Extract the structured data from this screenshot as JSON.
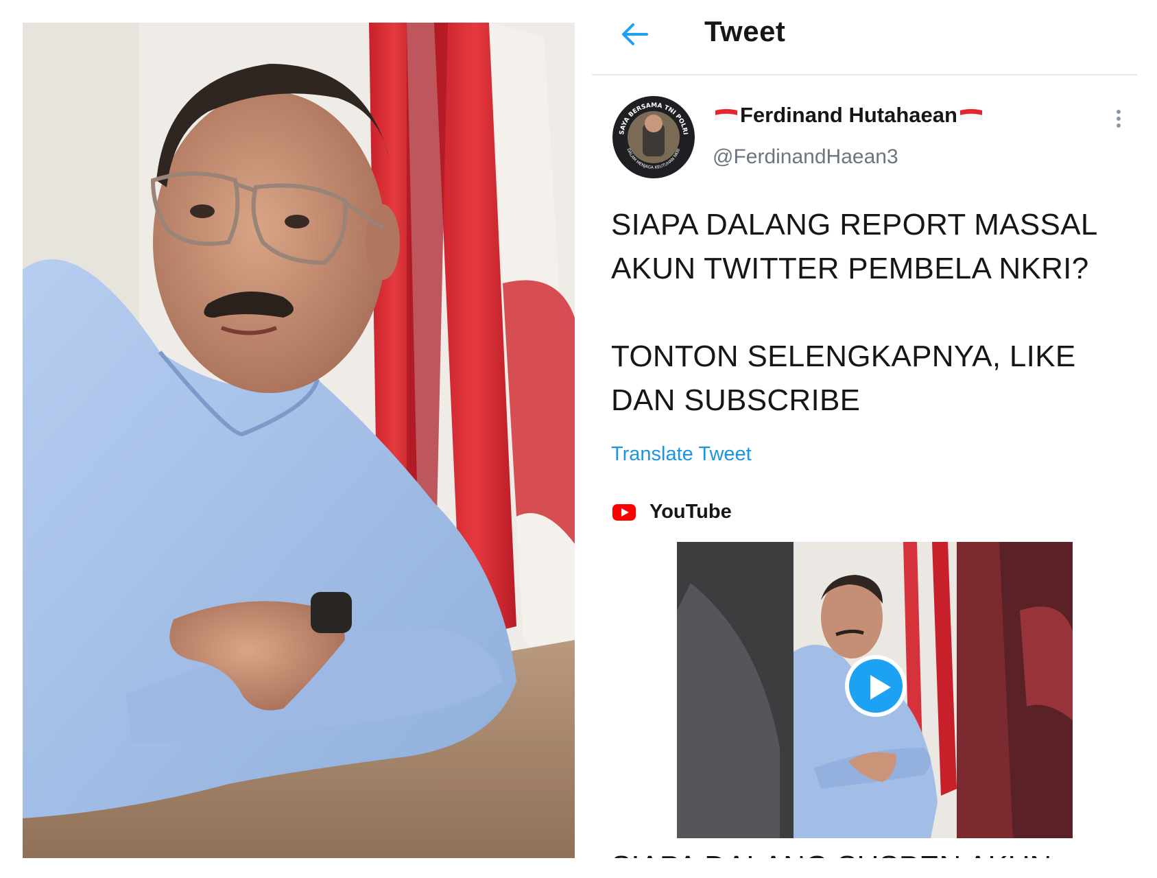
{
  "header": {
    "title": "Tweet",
    "back_icon": "arrow-left-icon"
  },
  "tweet": {
    "display_name": "Ferdinand Hutahaean",
    "handle": "@FerdinandHaean3",
    "avatar_text_top": "SAYA BERSAMA TNI POLRI",
    "avatar_text_bottom": "DALAM MENJAGA KEUTUHAN NKRI",
    "text_paragraph_1_line_1": "SIAPA DALANG REPORT MASSAL",
    "text_paragraph_1_line_2": "AKUN TWITTER PEMBELA NKRI?",
    "text_paragraph_2_line_1": "TONTON SELENGKAPNYA, LIKE",
    "text_paragraph_2_line_2": "DAN SUBSCRIBE",
    "translate_label": "Translate Tweet",
    "card_source": "YouTube",
    "card_title_cutoff": "SIAPA DALANG SUSPEN AKUN"
  },
  "colors": {
    "link": "#1b95e0",
    "play_button": "#1da1f2",
    "youtube_red": "#ff0000",
    "flag_red": "#e3262e",
    "text_primary": "#14171a",
    "text_secondary": "#6a7580",
    "shirt_blue": "#a9c3ea"
  }
}
